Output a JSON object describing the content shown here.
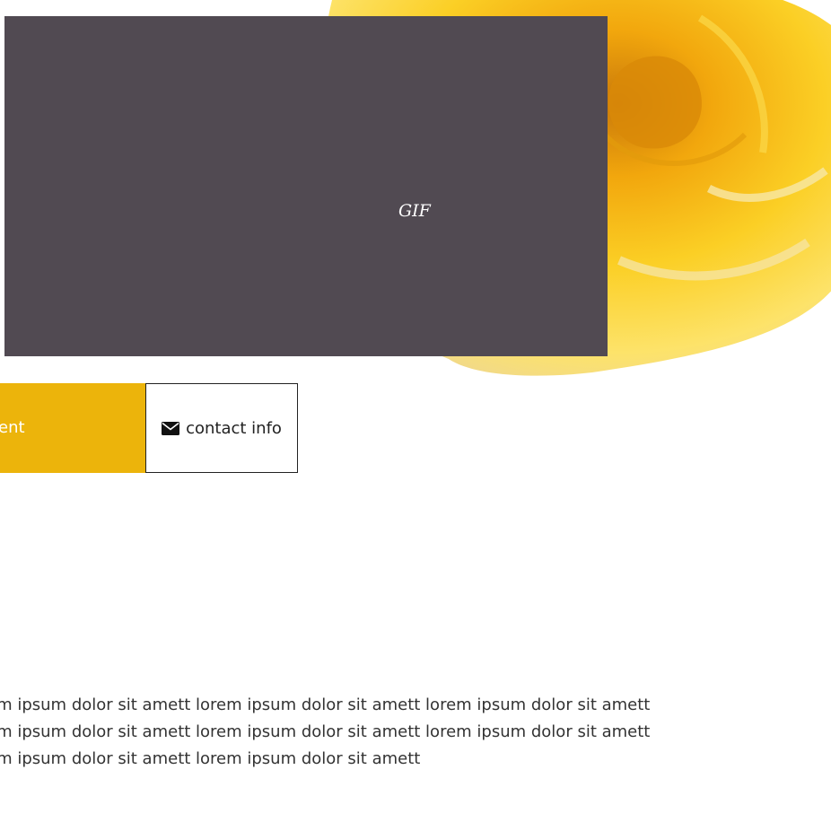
{
  "hero": {
    "gif_label": "GIF",
    "box_color": "#514a52",
    "image": "yellow-rose"
  },
  "buttons": {
    "content_label": "Content",
    "contact_label": "contact info",
    "contact_icon": "envelope-icon",
    "accent_color": "#ecb40b"
  },
  "paragraph": {
    "lines": [
      "lorem ipsum dolor sit amett lorem ipsum dolor sit amett lorem ipsum dolor sit amett",
      "lorem ipsum dolor sit amett lorem ipsum dolor sit amett lorem ipsum dolor sit amett",
      "lorem ipsum dolor sit amett lorem ipsum dolor sit amett"
    ]
  }
}
